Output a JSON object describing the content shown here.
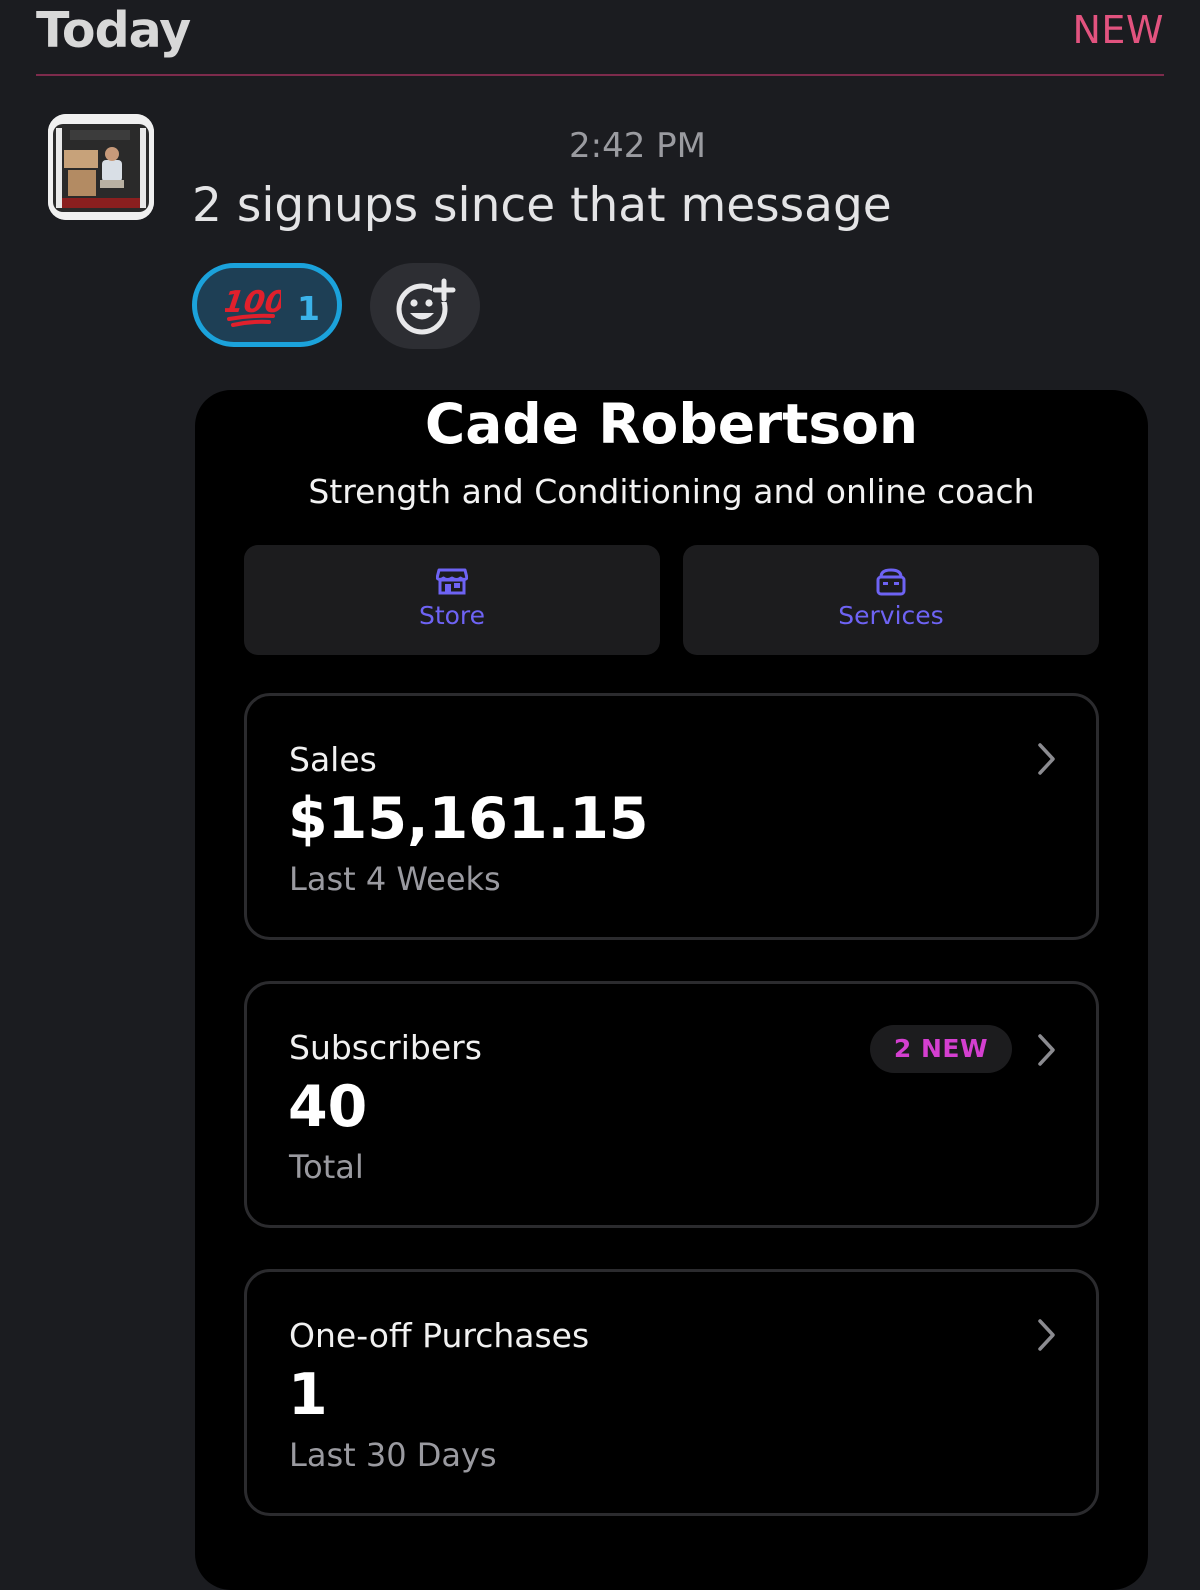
{
  "header": {
    "day": "Today",
    "new_divider_label": "NEW"
  },
  "message": {
    "timestamp": "2:42 PM",
    "text": "2 signups since that message",
    "avatar_icon": "user-avatar-photo"
  },
  "reactions": [
    {
      "emoji": "100",
      "icon": "hundred-points-icon",
      "count": "1",
      "selected": true,
      "color": "#1ba2db"
    }
  ],
  "add_reaction": {
    "icon": "add-reaction-icon"
  },
  "embed": {
    "profile_name": "Cade Robertson",
    "profile_subtitle": "Strength and Conditioning and online coach",
    "tabs": [
      {
        "label": "Store",
        "icon": "store-icon"
      },
      {
        "label": "Services",
        "icon": "services-icon"
      }
    ],
    "cards": [
      {
        "label": "Sales",
        "value": "$15,161.15",
        "caption": "Last 4 Weeks"
      },
      {
        "label": "Subscribers",
        "value": "40",
        "caption": "Total",
        "badge": "2 NEW"
      },
      {
        "label": "One-off Purchases",
        "value": "1",
        "caption": "Last 30 Days"
      }
    ]
  },
  "colors": {
    "background": "#1b1c20",
    "new_accent": "#e2537f",
    "reaction_accent": "#1ba2db",
    "tab_accent": "#6e63f4",
    "badge_accent": "#d43fd0"
  }
}
